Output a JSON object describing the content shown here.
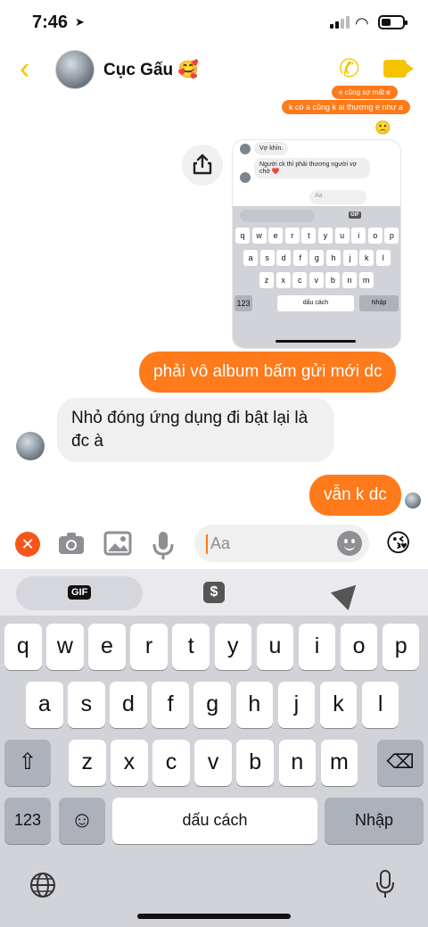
{
  "status": {
    "time": "7:46",
    "battery_level": 0.4
  },
  "header": {
    "contact_name": "Cục Gấu 🥰",
    "back_icon": "chevron-left-icon",
    "call_icon": "phone-icon",
    "video_icon": "video-camera-icon",
    "accent": "#f5c400"
  },
  "messages": {
    "partial_top_1": "e cũng sợ mất e",
    "partial_top_2": "k có a cũng k ai thương e như a",
    "reaction_emoji": "🙁",
    "screenshot": {
      "msg1": "Vợ khìn.",
      "msg2": "Người ck thì phải thương người vợ chớ ❤️",
      "input_placeholder": "Aa",
      "gif_label": "GIF",
      "row1": [
        "q",
        "w",
        "e",
        "r",
        "t",
        "y",
        "u",
        "i",
        "o",
        "p"
      ],
      "row2": [
        "a",
        "s",
        "d",
        "f",
        "g",
        "h",
        "j",
        "k",
        "l"
      ],
      "row3": [
        "z",
        "x",
        "c",
        "v",
        "b",
        "n",
        "m"
      ],
      "numbers_key": "123",
      "space_key": "dấu cách",
      "enter_key": "Nhập"
    },
    "sent_1": "phải vô album bấm gửi mới dc",
    "received_1": "Nhỏ đóng ứng dụng đi bật lại là đc à",
    "sent_2": "vẫn k dc",
    "outgoing_color": "#fe7a1a"
  },
  "composer": {
    "placeholder": "Aa",
    "emoji": "😘"
  },
  "keyboard": {
    "gif_label": "GIF",
    "sticker_label": "$",
    "row1": [
      "q",
      "w",
      "e",
      "r",
      "t",
      "y",
      "u",
      "i",
      "o",
      "p"
    ],
    "row2": [
      "a",
      "s",
      "d",
      "f",
      "g",
      "h",
      "j",
      "k",
      "l"
    ],
    "row3": [
      "z",
      "x",
      "c",
      "v",
      "b",
      "n",
      "m"
    ],
    "numbers_key": "123",
    "space_key": "dấu cách",
    "enter_key": "Nhập"
  }
}
